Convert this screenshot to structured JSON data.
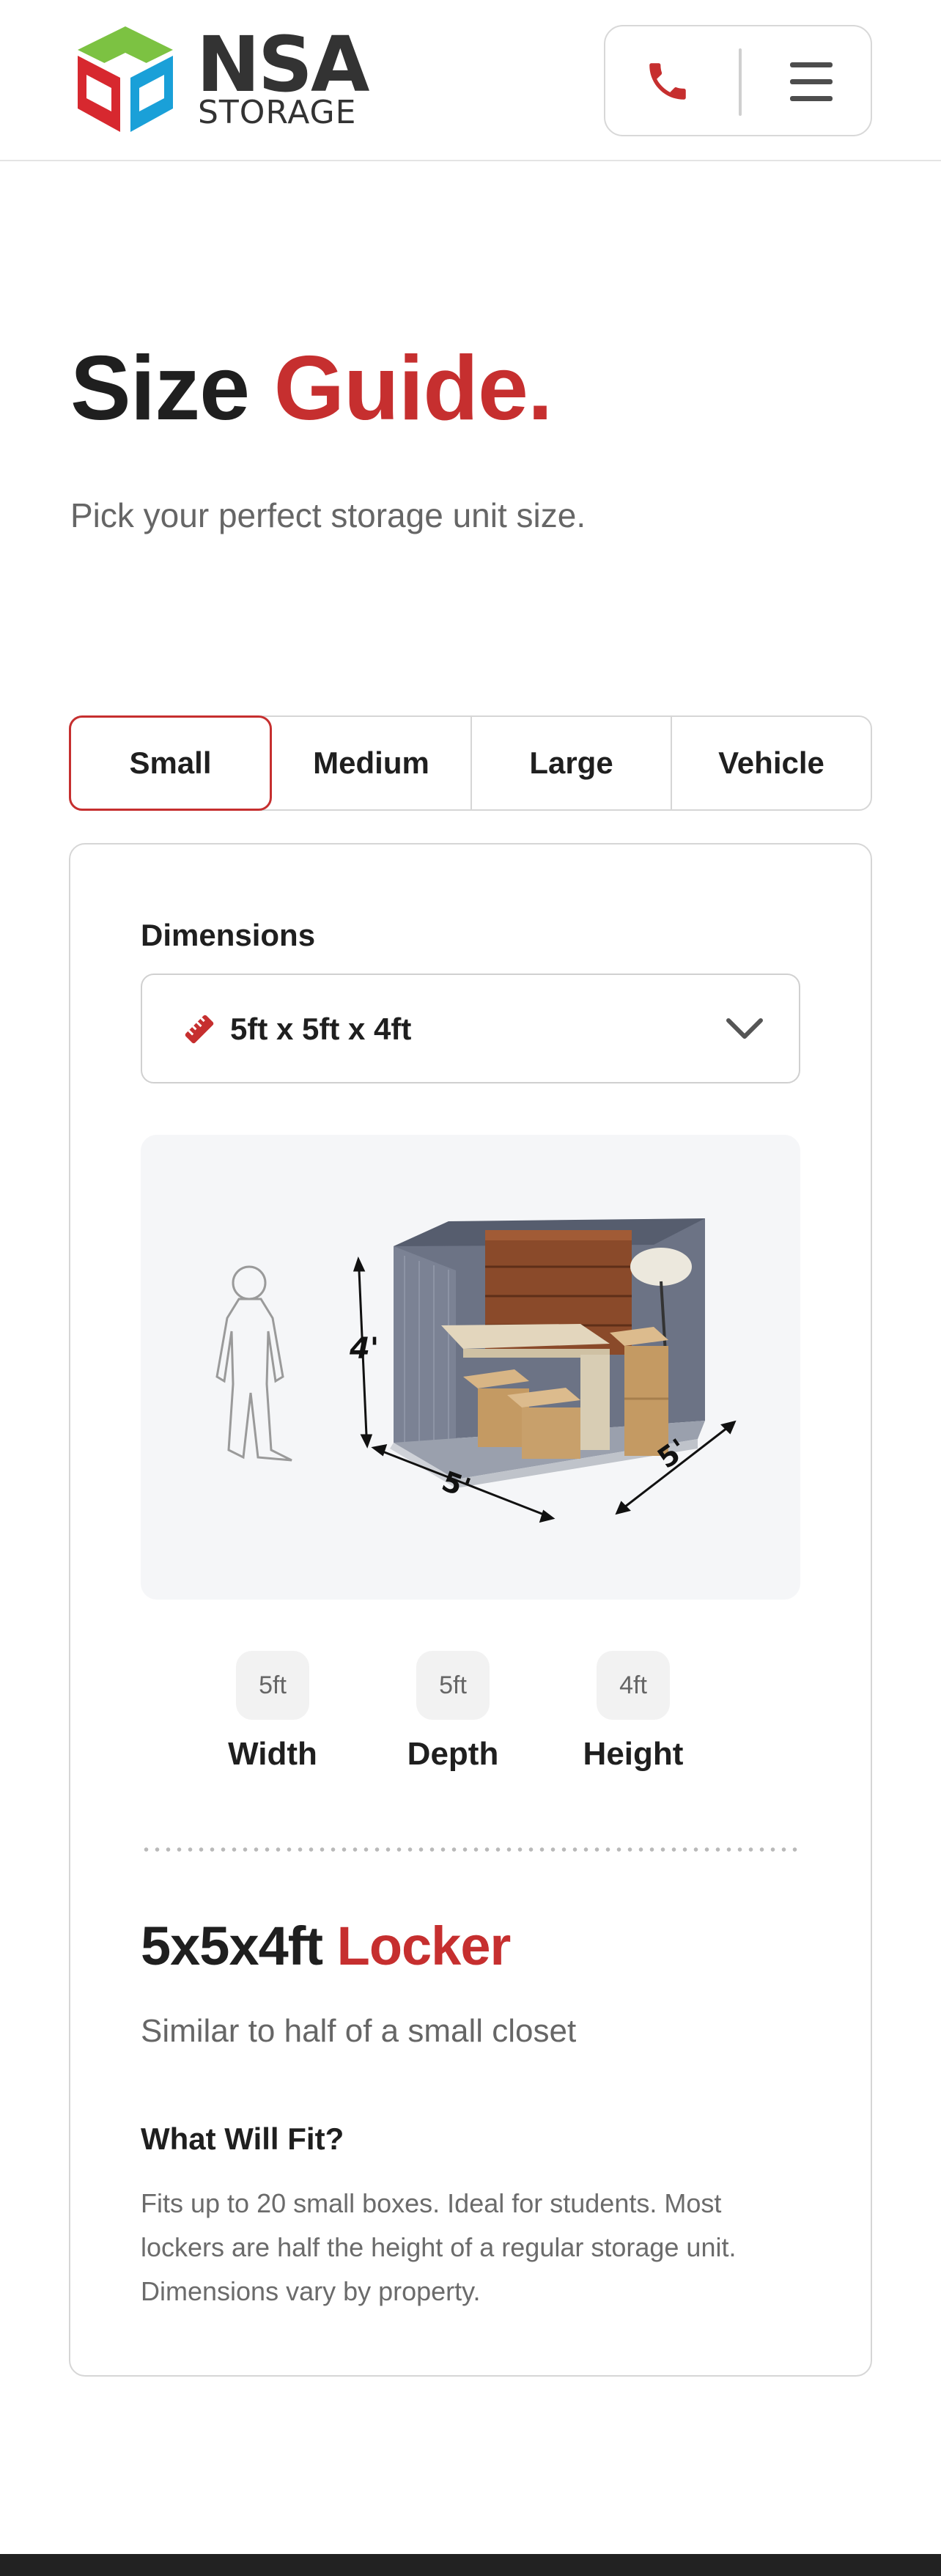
{
  "header": {
    "logo_word": "NSA",
    "logo_sub": "STORAGE",
    "phone_icon": "phone-icon",
    "menu_icon": "hamburger-menu-icon"
  },
  "hero": {
    "title_main": "Size",
    "title_accent": "Guide.",
    "subtitle": "Pick your perfect storage unit size."
  },
  "tabs": [
    {
      "label": "Small",
      "active": true
    },
    {
      "label": "Medium",
      "active": false
    },
    {
      "label": "Large",
      "active": false
    },
    {
      "label": "Vehicle",
      "active": false
    }
  ],
  "card": {
    "dimensions_label": "Dimensions",
    "selected_dimension": "5ft x 5ft x 4ft",
    "illustration": {
      "height_label": "4'",
      "width_label": "5'",
      "depth_label": "5'"
    },
    "metrics": [
      {
        "value": "5ft",
        "label": "Width"
      },
      {
        "value": "5ft",
        "label": "Depth"
      },
      {
        "value": "4ft",
        "label": "Height"
      }
    ],
    "unit_name_main": "5x5x4ft",
    "unit_name_accent": "Locker",
    "unit_compare": "Similar to half of a small closet",
    "fit_title": "What Will Fit?",
    "fit_text": "Fits up to 20 small boxes. Ideal for students. Most lockers are half the height of a regular storage unit. Dimensions vary by property."
  },
  "colors": {
    "accent": "#c62f2f",
    "logo_green": "#7cc242",
    "logo_red": "#d7282f",
    "logo_blue": "#1aa0d8"
  }
}
